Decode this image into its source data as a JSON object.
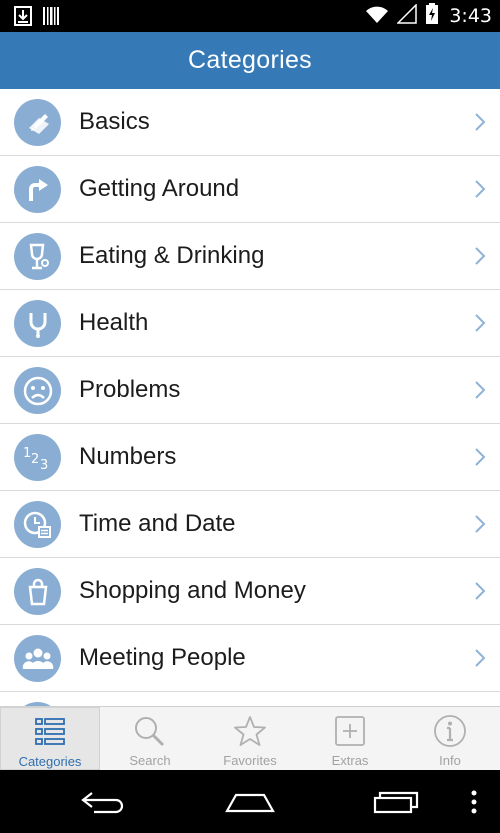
{
  "status_bar": {
    "time": "3:43",
    "icons": [
      "download-icon",
      "barcode-icon",
      "wifi-icon",
      "signal-icon",
      "battery-charging-icon"
    ]
  },
  "header": {
    "title": "Categories"
  },
  "categories": [
    {
      "label": "Basics",
      "icon": "pencil-note-icon"
    },
    {
      "label": "Getting Around",
      "icon": "turn-right-arrow-icon"
    },
    {
      "label": "Eating & Drinking",
      "icon": "glass-icon"
    },
    {
      "label": "Health",
      "icon": "stethoscope-icon"
    },
    {
      "label": "Problems",
      "icon": "sad-face-icon"
    },
    {
      "label": "Numbers",
      "icon": "numbers-123-icon"
    },
    {
      "label": "Time and Date",
      "icon": "clock-calendar-icon"
    },
    {
      "label": "Shopping and Money",
      "icon": "shopping-bag-icon"
    },
    {
      "label": "Meeting People",
      "icon": "people-icon"
    }
  ],
  "tabs": [
    {
      "label": "Categories",
      "icon": "list-icon",
      "active": true
    },
    {
      "label": "Search",
      "icon": "search-icon",
      "active": false
    },
    {
      "label": "Favorites",
      "icon": "star-icon",
      "active": false
    },
    {
      "label": "Extras",
      "icon": "plus-box-icon",
      "active": false
    },
    {
      "label": "Info",
      "icon": "info-icon",
      "active": false
    }
  ],
  "nav_bar": {
    "buttons": [
      "back-icon",
      "home-icon",
      "recent-apps-icon",
      "menu-icon"
    ]
  },
  "colors": {
    "header": "#3579b6",
    "icon_circle": "#8aaed3",
    "active_tab_text": "#2f6fb1",
    "inactive_tab": "#a2a2a2"
  }
}
